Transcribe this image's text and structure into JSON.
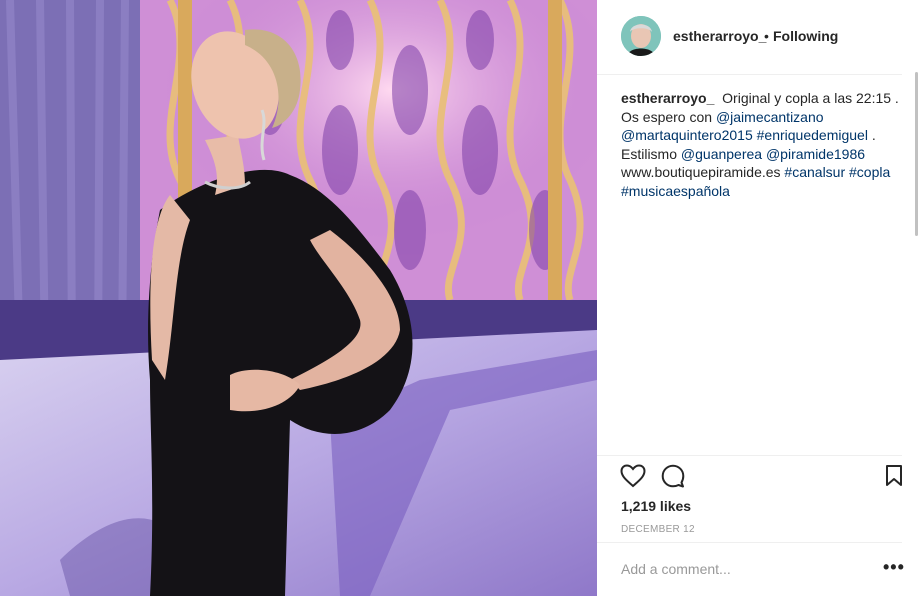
{
  "post": {
    "username": "estherarroyo_",
    "separator": "•",
    "follow_status": "Following"
  },
  "caption": {
    "username": "estherarroyo_",
    "t1": "Original y copla a las 22:15 . Os espero con ",
    "m1": "@jaimecantizano",
    "t2": " ",
    "m2": "@martaquintero2015",
    "t3": " ",
    "h1": "#enriquedemiguel",
    "t4": " . Estilismo ",
    "m3": "@guanperea",
    "t5": " ",
    "m4": "@piramide1986",
    "t6": " www.boutiquepiramide.es ",
    "h2": "#canalsur",
    "t7": " ",
    "h3": "#copla",
    "t8": " ",
    "h4": "#musicaespañola"
  },
  "actions": {
    "like_icon": "heart-icon",
    "comment_icon": "comment-icon",
    "save_icon": "bookmark-icon"
  },
  "likes": "1,219 likes",
  "date": "DECEMBER 12",
  "comment": {
    "placeholder": "Add a comment...",
    "more": "•••"
  },
  "colors": {
    "link": "#003569",
    "text": "#262626",
    "muted": "#999999",
    "divider": "#efefef"
  }
}
